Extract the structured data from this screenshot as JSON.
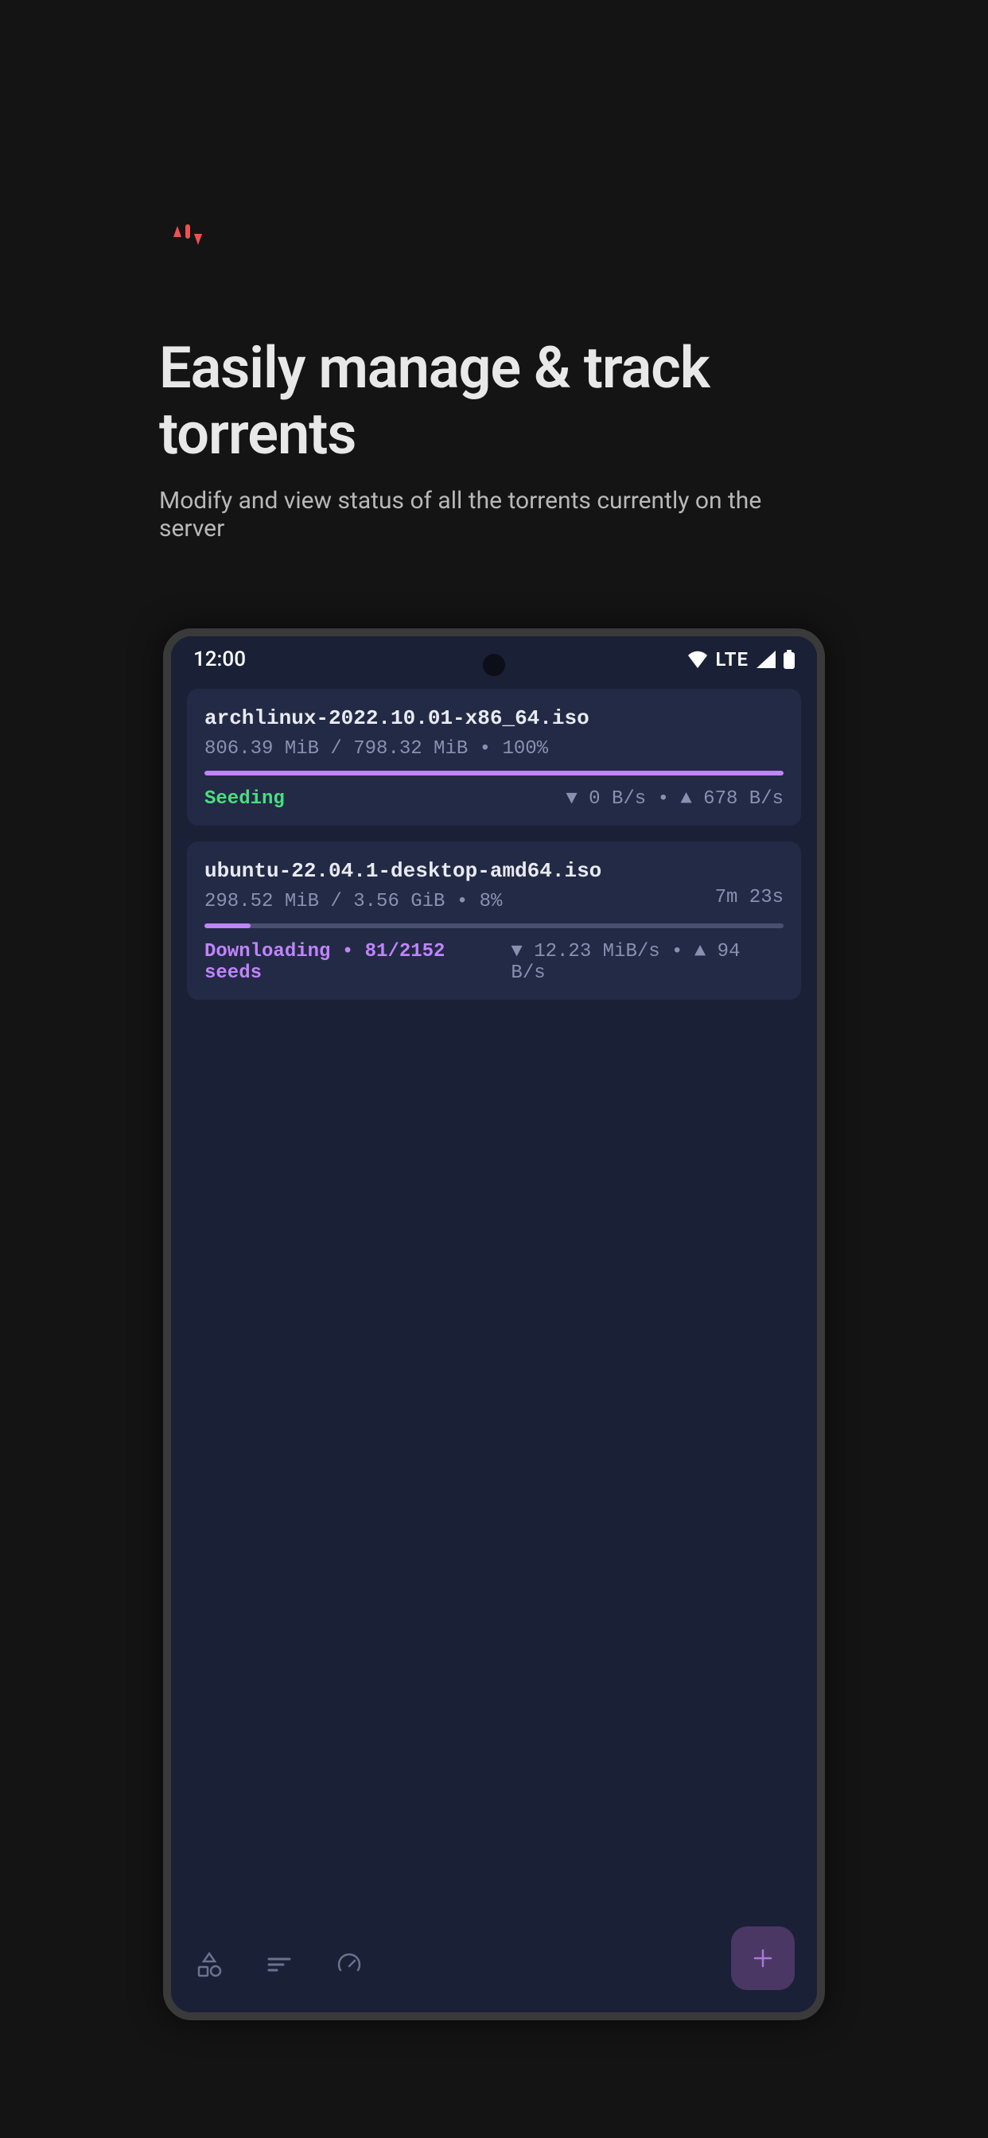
{
  "header": {
    "title": "Easily manage & track torrents",
    "subtitle": "Modify and view status of all the torrents currently on the server"
  },
  "statusbar": {
    "time": "12:00",
    "network": "LTE"
  },
  "torrents": [
    {
      "name": "archlinux-2022.10.01-x86_64.iso",
      "size_line": "806.39 MiB / 798.32 MiB • 100%",
      "eta": "",
      "progress_percent": 100,
      "progress_color": "#c084fc",
      "status_label": "Seeding",
      "status_class": "status-seeding",
      "speed": "▼ 0 B/s • ▲ 678 B/s"
    },
    {
      "name": "ubuntu-22.04.1-desktop-amd64.iso",
      "size_line": "298.52 MiB / 3.56 GiB • 8%",
      "eta": "7m 23s",
      "progress_percent": 8,
      "progress_color": "#c084fc",
      "status_label": "Downloading • 81/2152 seeds",
      "status_class": "status-downloading",
      "speed": "▼ 12.23 MiB/s • ▲ 94 B/s"
    }
  ]
}
